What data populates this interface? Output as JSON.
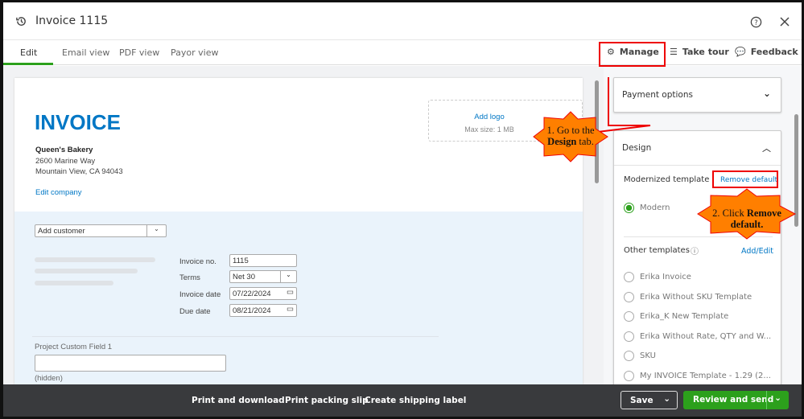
{
  "header": {
    "title": "Invoice 1115",
    "history_icon": "history-icon",
    "help_icon": "help-icon",
    "close_icon": "close-icon"
  },
  "tabs": [
    {
      "label": "Edit",
      "active": true
    },
    {
      "label": "Email view"
    },
    {
      "label": "PDF view"
    },
    {
      "label": "Payor view"
    }
  ],
  "toolbar": {
    "manage": "Manage",
    "take_tour": "Take tour",
    "feedback": "Feedback"
  },
  "invoice": {
    "heading": "INVOICE",
    "company_name": "Queen's Bakery",
    "address1": "2600 Marine Way",
    "address2": "Mountain View, CA 94043",
    "edit_company": "Edit company",
    "add_logo": "Add logo",
    "logo_max": "Max size: 1 MB",
    "customer_placeholder": "Add customer",
    "fields": {
      "invoice_no_label": "Invoice no.",
      "invoice_no": "1115",
      "terms_label": "Terms",
      "terms": "Net 30",
      "invoice_date_label": "Invoice date",
      "invoice_date": "07/22/2024",
      "due_date_label": "Due date",
      "due_date": "08/21/2024"
    },
    "custom_field_label": "Project Custom Field 1",
    "custom_field_value": "",
    "custom_field_note": "(hidden)"
  },
  "sidebar": {
    "payment_options": "Payment options",
    "design": "Design",
    "modernized_template": "Modernized template",
    "remove_default": "Remove default",
    "selected_template": "Modern",
    "other_templates": "Other templates",
    "add_edit": "Add/Edit",
    "templates": [
      "Erika Invoice",
      "Erika Without SKU Template",
      "Erika_K New Template",
      "Erika Without Rate, QTY and W...",
      "SKU",
      "My INVOICE Template - 1.29 (2..."
    ]
  },
  "footer": {
    "print_download": "Print and download",
    "print_packing": "Print packing slip",
    "shipping_label": "Create shipping label",
    "save": "Save",
    "review_send": "Review and send"
  },
  "annotations": {
    "step1_a": "1. Go to the",
    "step1_b": "Design",
    "step1_c": " tab.",
    "step2_a": "2. Click ",
    "step2_b": "Remove",
    "step2_c": "default."
  },
  "colors": {
    "brand_blue": "#0077c5",
    "green": "#2ca01c",
    "callout": "#ff7f00",
    "highlight": "#e00000"
  }
}
